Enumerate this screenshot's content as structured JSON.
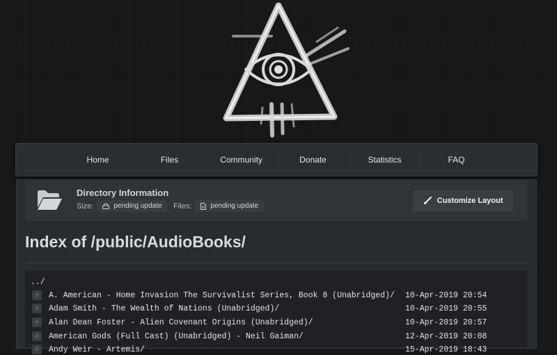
{
  "nav": {
    "items": [
      {
        "label": "Home"
      },
      {
        "label": "Files"
      },
      {
        "label": "Community"
      },
      {
        "label": "Donate"
      },
      {
        "label": "Statistics"
      },
      {
        "label": "FAQ"
      }
    ]
  },
  "directory_info": {
    "title": "Directory Information",
    "size_label": "Size:",
    "size_value": "pending update",
    "files_label": "Files:",
    "files_value": "pending update",
    "customize_button": "Customize Layout",
    "icons": [
      "folder-open-icon",
      "drive-icon",
      "document-icon",
      "brush-icon"
    ]
  },
  "page": {
    "title": "Index of /public/AudioBooks/",
    "parent_link": "../"
  },
  "listing": {
    "rows": [
      {
        "name": "A. American - Home Invasion The Survivalist Series, Book 8 (Unabridged)/",
        "date": "10-Apr-2019 20:54"
      },
      {
        "name": "Adam Smith - The Wealth of Nations (Unabridged)/",
        "date": "10-Apr-2019 20:55"
      },
      {
        "name": "Alan Dean Foster - Alien Covenant Origins (Unabridged)/",
        "date": "10-Apr-2019 20:57"
      },
      {
        "name": "American Gods (Full Cast) (Unabridged) - Neil Gaiman/",
        "date": "12-Apr-2019 20:08"
      },
      {
        "name": "Andy Weir - Artemis/",
        "date": "15-Apr-2019 18:43"
      }
    ]
  },
  "colors": {
    "background": "#141516",
    "panel": "#282b2f",
    "nav": "#2a2d31",
    "listing": "#1f2124"
  }
}
